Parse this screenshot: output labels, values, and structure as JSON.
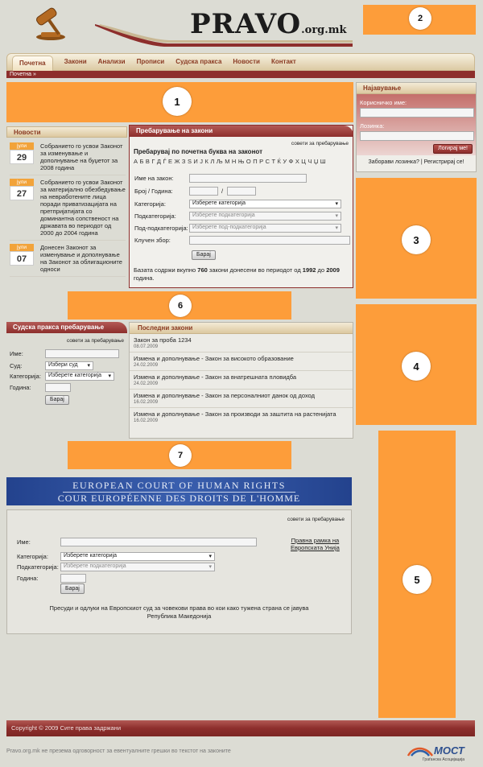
{
  "header": {
    "logo_main": "PRAVO",
    "logo_suffix": ".org.mk",
    "gavel_icon": "gavel-icon",
    "accent_color": "#8d2e2c",
    "orange_color": "#fd9d3a"
  },
  "nav": {
    "items": [
      "Почетна",
      "Закони",
      "Анализи",
      "Прописи",
      "Судска пракса",
      "Новости",
      "Контакт"
    ],
    "active": "Почетна"
  },
  "breadcrumb": "Почетна »",
  "placeholders": {
    "p1": "1",
    "p2": "2",
    "p3": "3",
    "p4": "4",
    "p5": "5",
    "p6": "6",
    "p7": "7"
  },
  "login": {
    "title": "Најавување",
    "username_label": "Корисничко име:",
    "password_label": "Лозинка:",
    "button": "Логирај ме!",
    "forgot": "Заборави лозинка?",
    "sep": "|",
    "register": "Регистрирај се!"
  },
  "news": {
    "title": "Новости",
    "items": [
      {
        "month": "јули",
        "day": "29",
        "text": "Собранието го усвои Законот за изменување и дополнување на буџетот за 2008 година"
      },
      {
        "month": "јули",
        "day": "27",
        "text": "Собранието го усвои Законот за материјално обезбедување на невработените лица поради приватизацијата на претпријатијата со доминантна сопственост на државата во периодот од 2000 до 2004 година"
      },
      {
        "month": "јули",
        "day": "07",
        "text": "Донесен Законот за изменување и дополнување на Законот за облигационите односи"
      }
    ]
  },
  "law_search": {
    "title": "Пребарување на закони",
    "tips": "совети за пребарување",
    "letter_heading": "Пребарувај по почетна буква на законот",
    "letters": "А Б В Г Д Ѓ Е Ж З Ѕ И Ј К Л Љ М Н Њ О П Р С Т Ќ У Ф Х Ц Ч Џ Ш",
    "name_label": "Име на закон:",
    "number_label": "Број / Година:",
    "slash": "/",
    "category_label": "Категорија:",
    "category_value": "Изберете категорија",
    "subcategory_label": "Подкатегорија:",
    "subcategory_value": "Изберете подкатегорија",
    "subsubcategory_label": "Под-подкатегорија:",
    "subsubcategory_value": "Изберете под-подкатегорија",
    "keyword_label": "Клучен збор:",
    "button": "Барај",
    "footer_pre": "Базата содржи вкупно ",
    "count": "760",
    "footer_mid": " закони донесени во периодот од ",
    "year_from": "1992",
    "footer_to": " до ",
    "year_to": "2009",
    "footer_end": " година."
  },
  "court_search": {
    "title": "Судска пракса пребарување",
    "tips": "совети за пребарување",
    "name_label": "Име:",
    "court_label": "Суд:",
    "court_value": "Избери суд",
    "category_label": "Категорија:",
    "category_value": "Изберете категорија",
    "year_label": "Година:",
    "button": "Барај"
  },
  "latest_laws": {
    "title": "Последни закони",
    "items": [
      {
        "title": "Закон за проба 1234",
        "date": "08.07.2009"
      },
      {
        "title": "Измена и дополнување - Закон за високото образование",
        "date": "24.02.2009"
      },
      {
        "title": "Измена и дополнување - Закон за внатрешната пловидба",
        "date": "24.02.2009"
      },
      {
        "title": "Измена и дополнување - Закон за персоналниот данок од доход",
        "date": "16.02.2009"
      },
      {
        "title": "Измена и дополнување - Закон за производи за заштита на растенијата",
        "date": "16.02.2009"
      }
    ]
  },
  "echr": {
    "banner_line1": "EUROPEAN COURT OF HUMAN RIGHTS",
    "banner_line2": "COUR EUROPÉENNE DES DROITS DE L'HOMME",
    "tips": "совети за пребарување",
    "name_label": "Име:",
    "eu_link_line1": "Правна рамка на",
    "eu_link_line2": "Европската Унија",
    "category_label": "Категорија:",
    "category_value": "Изберете категорија",
    "subcategory_label": "Подкатегорија:",
    "subcategory_value": "Изберете подкатегорија",
    "year_label": "Година:",
    "button": "Барај",
    "note": "Пресуди и одлуки на Европскиот суд за човекови права во кои како тужена страна се јавува Република Македонија"
  },
  "footer": {
    "copyright": "Copyright © 2009 Сите права задржани",
    "disclaimer": "Pravo.org.mk не презема одговорност за евентуалните грешки во текстот на законите",
    "partner_name": "МОСТ",
    "partner_sub": "Граѓанска Асоцијација"
  }
}
